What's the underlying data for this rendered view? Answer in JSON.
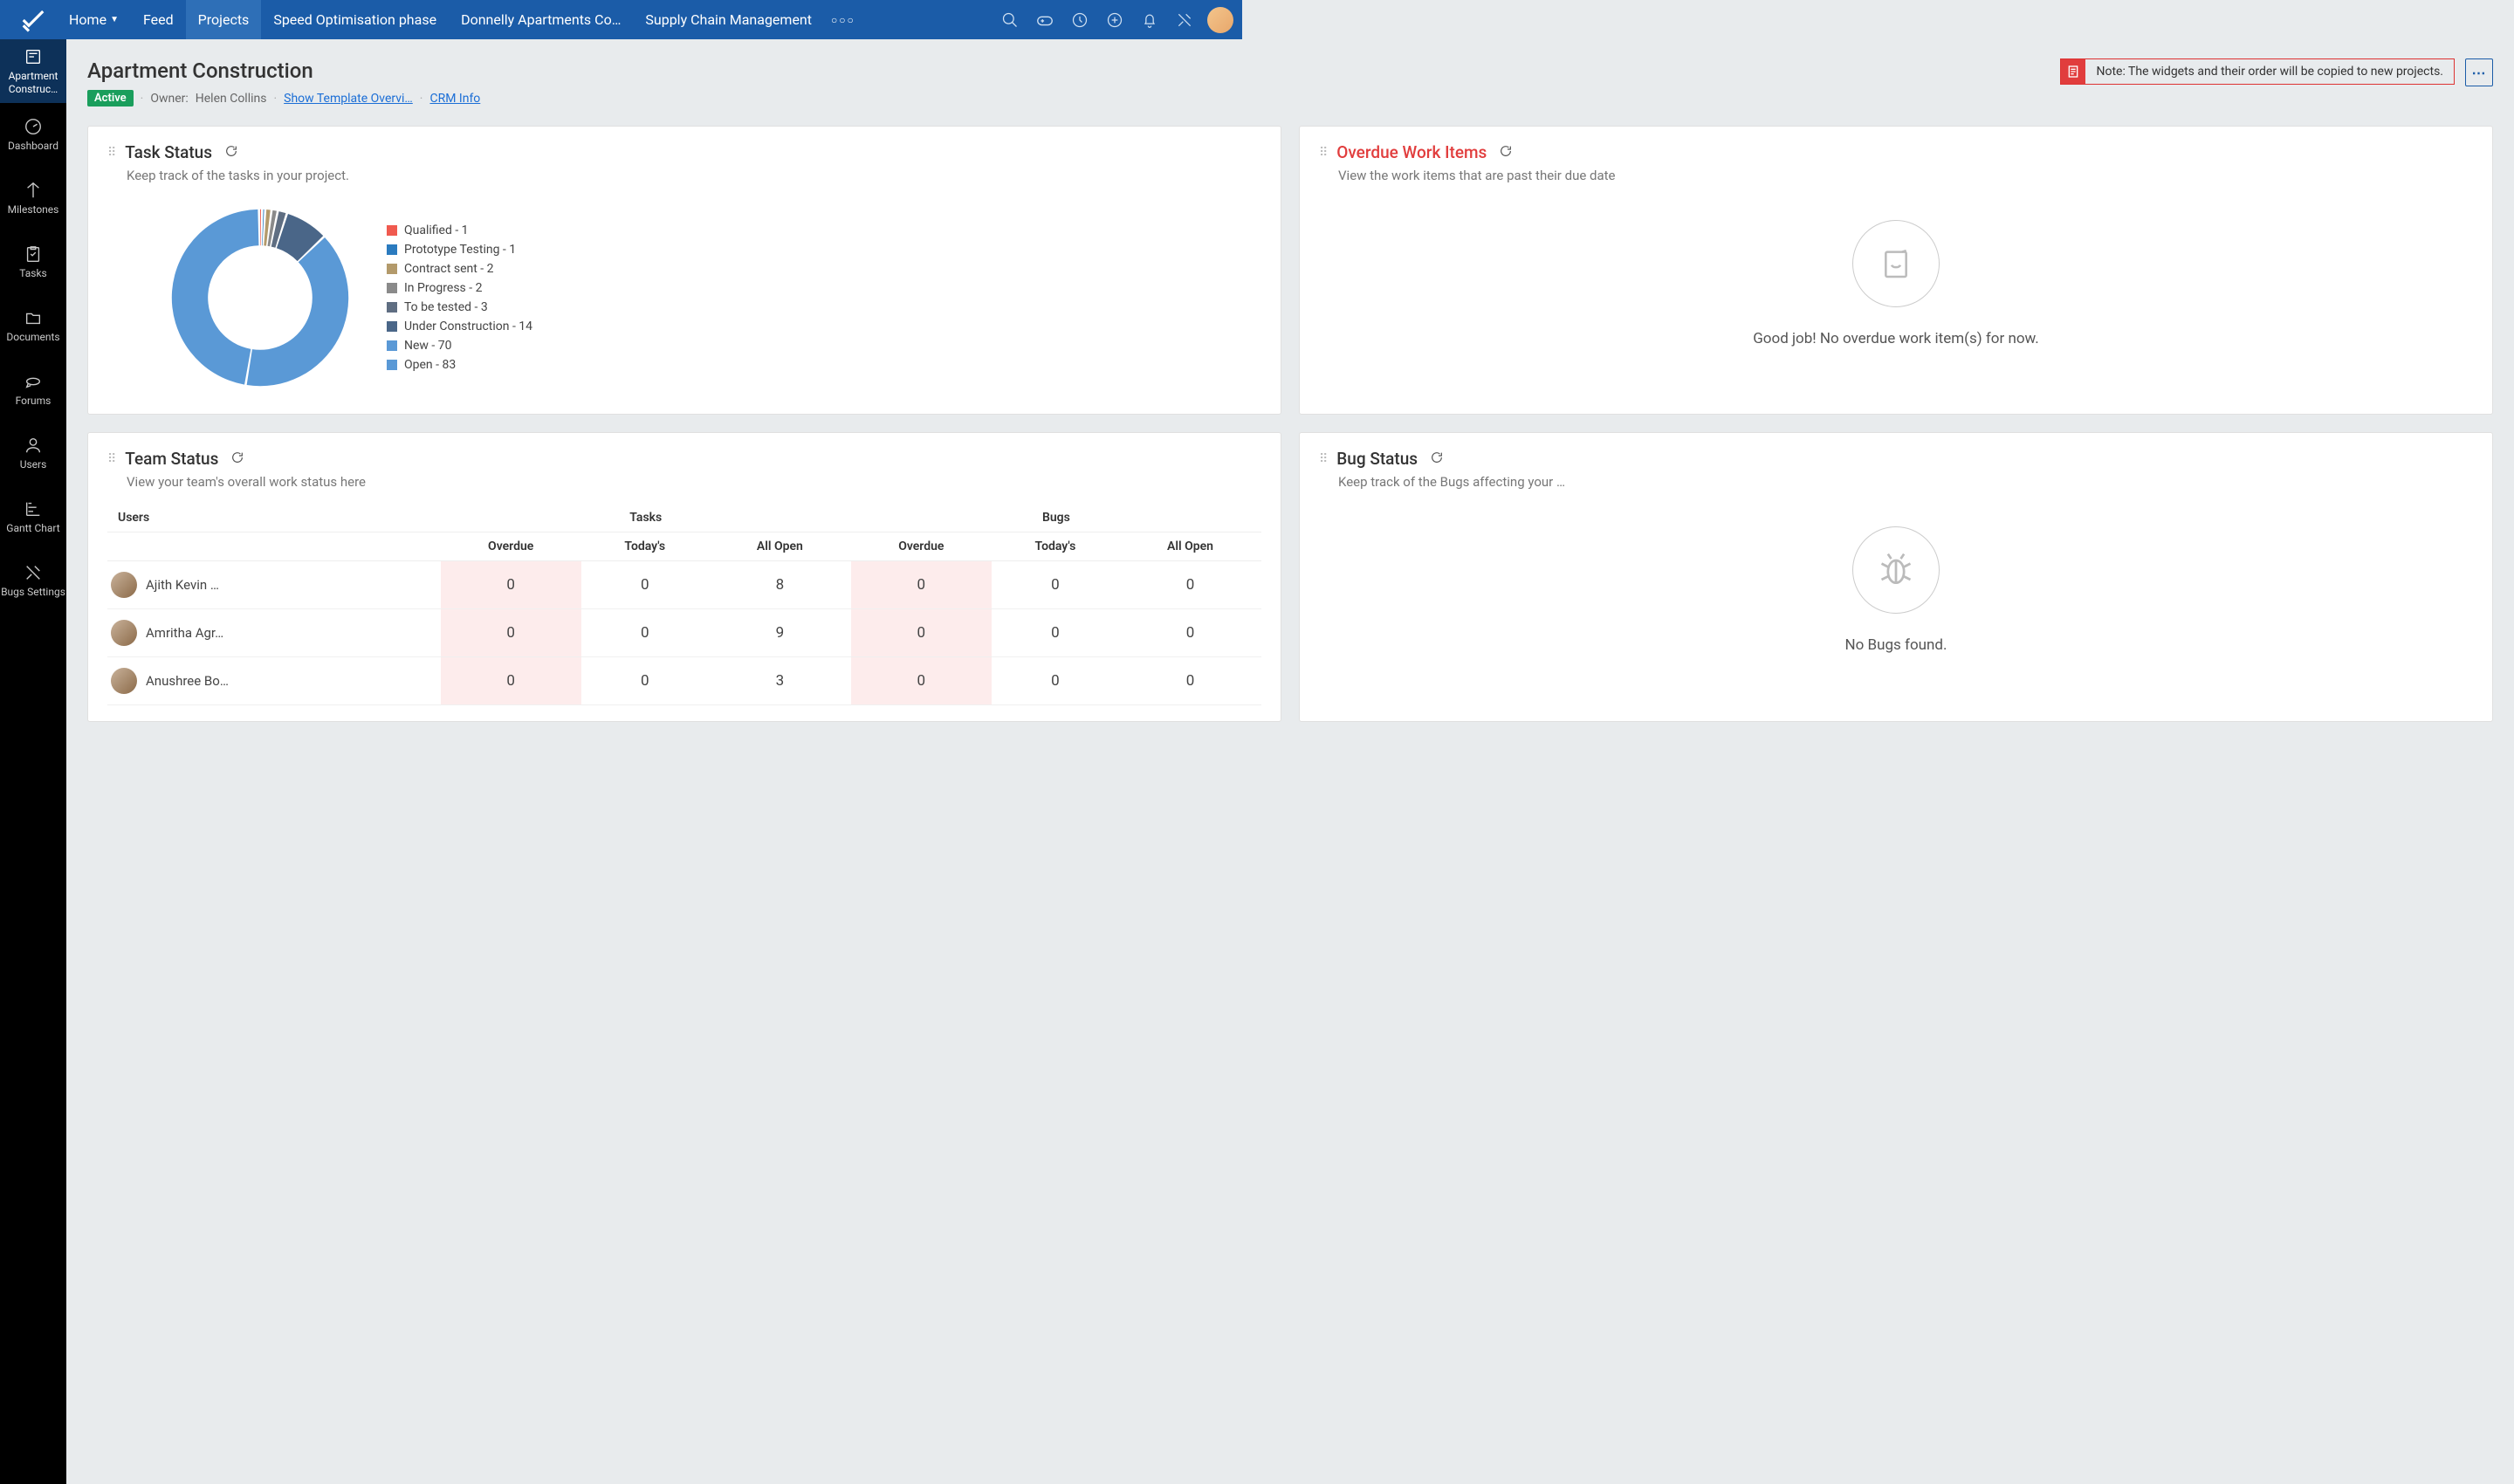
{
  "topnav": {
    "home": "Home",
    "feed": "Feed",
    "projects": "Projects",
    "tabs": [
      "Speed Optimisation phase",
      "Donnelly Apartments Co…",
      "Supply Chain Management"
    ]
  },
  "sidebar": {
    "items": [
      {
        "label": "Apartment Construc…",
        "active": true
      },
      {
        "label": "Dashboard"
      },
      {
        "label": "Milestones"
      },
      {
        "label": "Tasks"
      },
      {
        "label": "Documents"
      },
      {
        "label": "Forums"
      },
      {
        "label": "Users"
      },
      {
        "label": "Gantt Chart"
      },
      {
        "label": "Bugs Settings"
      }
    ]
  },
  "page": {
    "title": "Apartment Construction",
    "status": "Active",
    "owner_label": "Owner:",
    "owner_name": "Helen Collins",
    "template_link": "Show Template Overvi…",
    "crm_link": "CRM Info",
    "note": "Note: The widgets and their order will be copied to new projects."
  },
  "widgets": {
    "task_status": {
      "title": "Task Status",
      "subtitle": "Keep track of the tasks in your project."
    },
    "overdue": {
      "title": "Overdue Work Items",
      "subtitle": "View the work items that are past their due date",
      "empty": "Good job! No overdue work item(s) for now."
    },
    "team": {
      "title": "Team Status",
      "subtitle": "View your team's overall work status here",
      "col_users": "Users",
      "col_tasks": "Tasks",
      "col_bugs": "Bugs",
      "sub_overdue": "Overdue",
      "sub_today": "Today's",
      "sub_allopen": "All Open",
      "rows": [
        {
          "name": "Ajith Kevin …",
          "t_over": "0",
          "t_today": "0",
          "t_open": "8",
          "b_over": "0",
          "b_today": "0",
          "b_open": "0"
        },
        {
          "name": "Amritha Agr…",
          "t_over": "0",
          "t_today": "0",
          "t_open": "9",
          "b_over": "0",
          "b_today": "0",
          "b_open": "0"
        },
        {
          "name": "Anushree Bo…",
          "t_over": "0",
          "t_today": "0",
          "t_open": "3",
          "b_over": "0",
          "b_today": "0",
          "b_open": "0"
        }
      ]
    },
    "bug": {
      "title": "Bug Status",
      "subtitle": "Keep track of the Bugs affecting your …",
      "empty": "No Bugs found."
    }
  },
  "chart_data": {
    "type": "pie",
    "title": "Task Status",
    "series": [
      {
        "name": "Qualified",
        "value": 1,
        "color": "#f05a4f"
      },
      {
        "name": "Prototype Testing",
        "value": 1,
        "color": "#2b7bbf"
      },
      {
        "name": "Contract sent",
        "value": 2,
        "color": "#b39a6b"
      },
      {
        "name": "In Progress",
        "value": 2,
        "color": "#8a8a8a"
      },
      {
        "name": "To be tested",
        "value": 3,
        "color": "#5f6e82"
      },
      {
        "name": "Under Construction",
        "value": 14,
        "color": "#4a6688"
      },
      {
        "name": "New",
        "value": 70,
        "color": "#5a99d6"
      },
      {
        "name": "Open",
        "value": 83,
        "color": "#5a99d6"
      }
    ]
  }
}
